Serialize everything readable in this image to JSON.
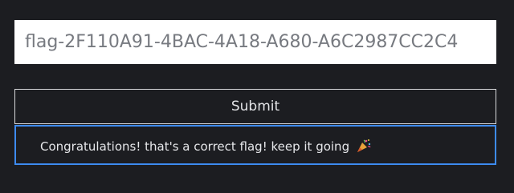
{
  "flag_input": {
    "value": "flag-2F110A91-4BAC-4A18-A680-A6C2987CC2C4"
  },
  "submit_button": {
    "label": "Submit"
  },
  "result": {
    "message": "Congratulations! that's a correct flag! keep it going",
    "icon": "party-popper-icon"
  },
  "colors": {
    "background": "#1c1d21",
    "accent": "#3d8bf0"
  }
}
